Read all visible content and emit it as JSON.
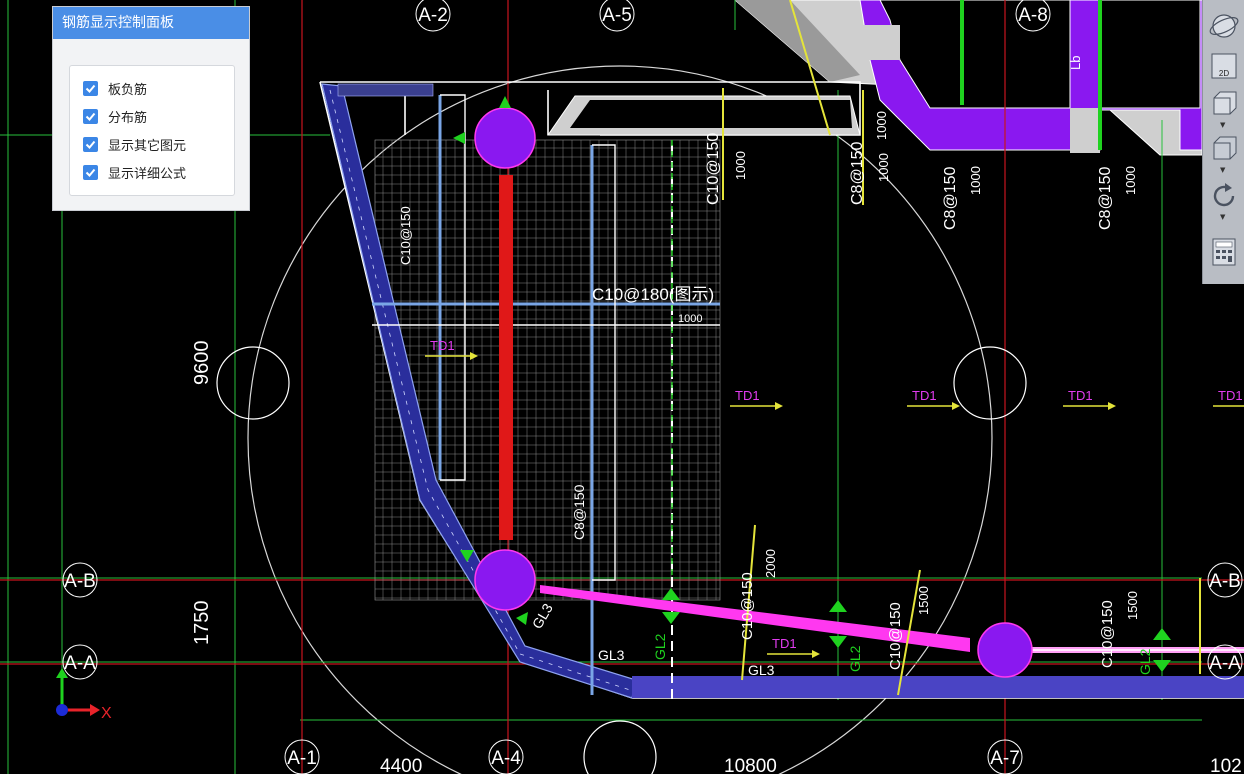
{
  "panel": {
    "title": "钢筋显示控制面板",
    "options": [
      {
        "label": "板负筋",
        "checked": true
      },
      {
        "label": "分布筋",
        "checked": true
      },
      {
        "label": "显示其它图元",
        "checked": true
      },
      {
        "label": "显示详细公式",
        "checked": true
      }
    ]
  },
  "toolbar": {
    "buttons": [
      {
        "icon": "orbit-sphere-icon"
      },
      {
        "icon": "view-2d-icon",
        "label": "2D"
      },
      {
        "icon": "view-3d-box-icon"
      },
      {
        "icon": "view-solid-box-icon"
      },
      {
        "icon": "rotate-icon"
      },
      {
        "icon": "calculator-icon"
      }
    ]
  },
  "grid_axes": {
    "top": [
      "A-2",
      "A-5",
      "A-8"
    ],
    "bottom": [
      "A-1",
      "A-4",
      "A-7"
    ],
    "left": [
      "A-B",
      "A-A"
    ],
    "right": [
      "A-B",
      "A-A"
    ]
  },
  "dimensions": {
    "bottom": [
      "4400",
      "10800",
      "102"
    ],
    "left": [
      "9600",
      "1750"
    ]
  },
  "rebar_labels": {
    "top": [
      "C10@150",
      "C8@150",
      "C8@150",
      "C8@150"
    ],
    "lengths_top": [
      "1000",
      "1000",
      "1000",
      "1000",
      "1000"
    ],
    "bottom": [
      "C10@150",
      "C10@150",
      "C10@150"
    ],
    "lengths_bottom": [
      "2000",
      "1500",
      "1500"
    ],
    "center": "C10@180(图示)",
    "center_small": "1000",
    "vertical_center": "C8@150",
    "vertical_left": "C10@150",
    "beam_marks": [
      "TD1",
      "TD1",
      "TD1",
      "TD1",
      "TD1",
      "TD1"
    ],
    "girder_marks": [
      "GL3",
      "GL3",
      "GL2",
      "GL2",
      "GL2",
      "GL3"
    ],
    "lb": "Lb"
  },
  "axis_indicator": {
    "x": "X",
    "colors": {
      "x": "#e8232a",
      "y": "#1fd21f",
      "origin": "#1c2bd6"
    }
  },
  "colors": {
    "grid_red": "#c8141e",
    "dim_green": "#28c03c",
    "slab_purple": "#8a18f0",
    "rebar_blue": "#7aa6e6",
    "rebar_red": "#e01818",
    "magenta": "#ff38f0",
    "yellow": "#e4e43a",
    "panel_header": "#4a8ee6"
  }
}
